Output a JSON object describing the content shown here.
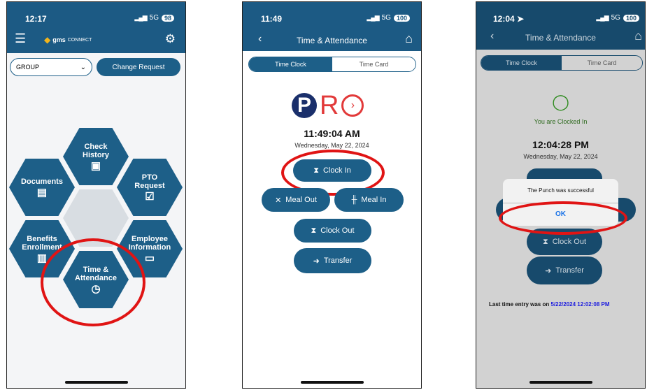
{
  "screens": {
    "home": {
      "time": "12:17",
      "signal": "5G",
      "battery": "98",
      "brand": "gms",
      "brand_suffix": "CONNECT",
      "group_value": "GROUP",
      "change_request": "Change Request",
      "tiles": {
        "check_history": "Check History",
        "documents": "Documents",
        "pto_request": "PTO Request",
        "benefits": "Benefits Enrollment",
        "employee_info": "Employee Information",
        "time_attendance": "Time & Attendance"
      }
    },
    "clock": {
      "time": "11:49",
      "signal": "5G",
      "battery": "100",
      "title": "Time & Attendance",
      "tab_clock": "Time Clock",
      "tab_card": "Time Card",
      "logo_p": "P",
      "logo_r": "R",
      "clock_time": "11:49:04 AM",
      "clock_date": "Wednesday, May 22, 2024",
      "clock_in": "Clock In",
      "meal_out": "Meal Out",
      "meal_in": "Meal In",
      "clock_out": "Clock Out",
      "transfer": "Transfer"
    },
    "punch": {
      "time": "12:04",
      "signal": "5G",
      "battery": "100",
      "title": "Time & Attendance",
      "tab_clock": "Time Clock",
      "tab_card": "Time Card",
      "status_text": "You are Clocked In",
      "clock_time": "12:04:28 PM",
      "clock_date": "Wednesday, May 22, 2024",
      "alert_message": "The Punch was successful",
      "alert_ok": "OK",
      "clock_out": "Clock Out",
      "transfer": "Transfer",
      "last_entry_label": "Last time entry was on ",
      "last_entry_value": "5/22/2024 12:02:08 PM"
    }
  },
  "colors": {
    "primary": "#1d5f88",
    "highlight": "#e01414",
    "success": "#2e8b1e",
    "link": "#1a1adf"
  }
}
